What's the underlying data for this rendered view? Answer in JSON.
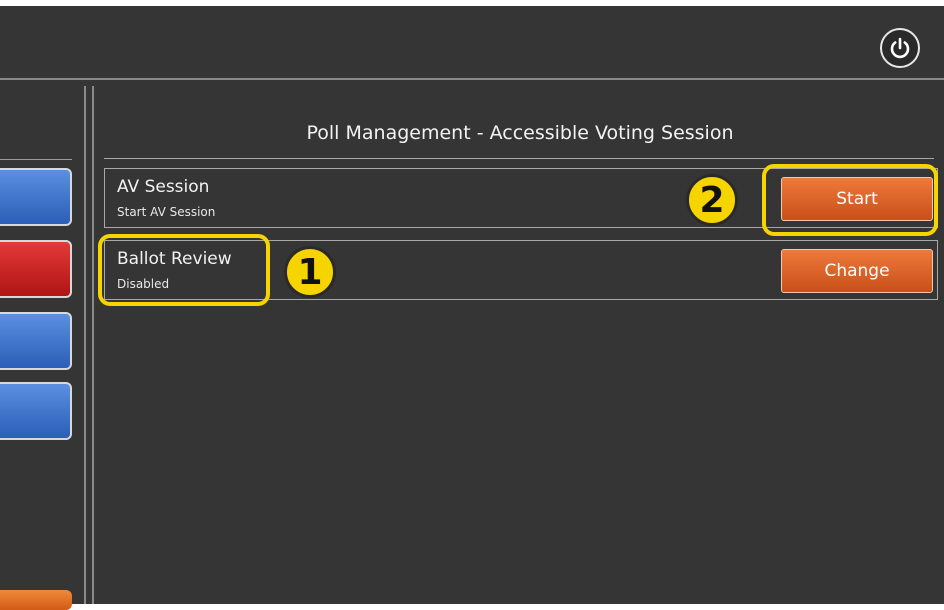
{
  "header": {
    "power_icon": "power-icon"
  },
  "panel": {
    "title": "Poll Management - Accessible Voting Session",
    "rows": [
      {
        "name": "AV Session",
        "status": "Start AV Session",
        "button": "Start"
      },
      {
        "name": "Ballot Review",
        "status": "Disabled",
        "button": "Change"
      }
    ]
  },
  "callouts": [
    "1",
    "2"
  ],
  "colors": {
    "background": "#353535",
    "action_button": "#d8601f",
    "highlight": "#f5d400",
    "left_blue": "#3a6fc8",
    "left_red": "#c81e1e"
  }
}
